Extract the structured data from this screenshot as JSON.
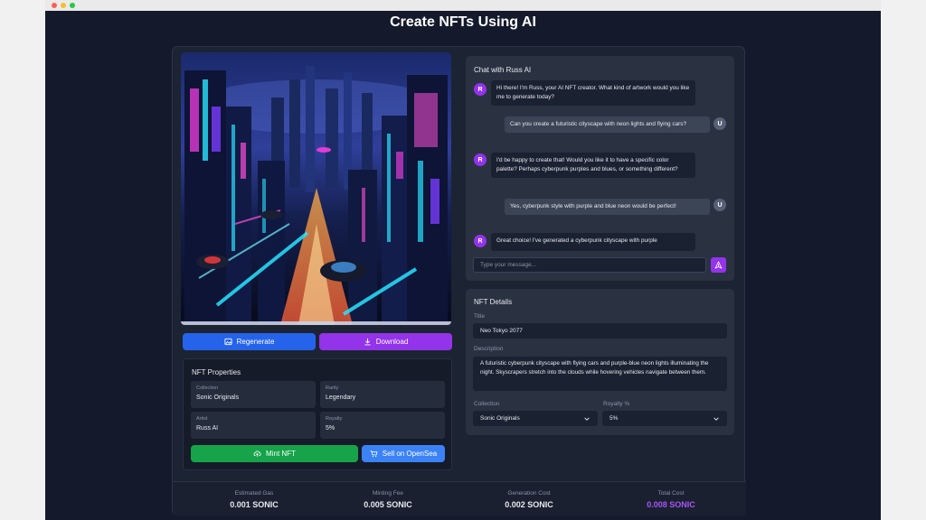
{
  "page": {
    "title": "Create NFTs Using AI"
  },
  "buttons": {
    "regenerate": "Regenerate",
    "download": "Download",
    "mint": "Mint NFT",
    "sell": "Sell on OpenSea"
  },
  "properties": {
    "title": "NFT Properties",
    "items": [
      {
        "label": "Collection",
        "value": "Sonic Originals"
      },
      {
        "label": "Rarity",
        "value": "Legendary"
      },
      {
        "label": "Artist",
        "value": "Russ AI"
      },
      {
        "label": "Royalty",
        "value": "5%"
      }
    ]
  },
  "chat": {
    "title": "Chat with Russ AI",
    "ai_initial": "R",
    "user_initial": "U",
    "messages": [
      {
        "from": "ai",
        "text": "Hi there! I'm Russ, your AI NFT creator. What kind of artwork would you like me to generate today?"
      },
      {
        "from": "user",
        "text": "Can you create a futuristic cityscape with neon lights and flying cars?"
      },
      {
        "from": "ai",
        "text": "I'd be happy to create that! Would you like it to have a specific color palette? Perhaps cyberpunk purples and blues, or something different?"
      },
      {
        "from": "user",
        "text": "Yes, cyberpunk style with purple and blue neon would be perfect!"
      },
      {
        "from": "ai",
        "text": "Great choice! I've generated a cyberpunk cityscape with purple"
      }
    ],
    "input_placeholder": "Type your message..."
  },
  "details": {
    "title": "NFT Details",
    "title_label": "Title",
    "title_value": "Neo Tokyo 2077",
    "description_label": "Description",
    "description_value": "A futuristic cyberpunk cityscape with flying cars and purple-blue neon lights illuminating the night. Skyscrapers stretch into the clouds while hovering vehicles navigate between them.",
    "collection_label": "Collection",
    "collection_value": "Sonic Originals",
    "royalty_label": "Royalty %",
    "royalty_value": "5%"
  },
  "costs": [
    {
      "label": "Estimated Gas",
      "value": "0.001 SONIC"
    },
    {
      "label": "Minting Fee",
      "value": "0.005 SONIC"
    },
    {
      "label": "Generation Cost",
      "value": "0.002 SONIC"
    },
    {
      "label": "Total Cost",
      "value": "0.008 SONIC"
    }
  ],
  "colors": {
    "accent_purple": "#9333ea",
    "accent_blue": "#2563eb",
    "accent_green": "#16a34a",
    "background": "#141a2b"
  }
}
